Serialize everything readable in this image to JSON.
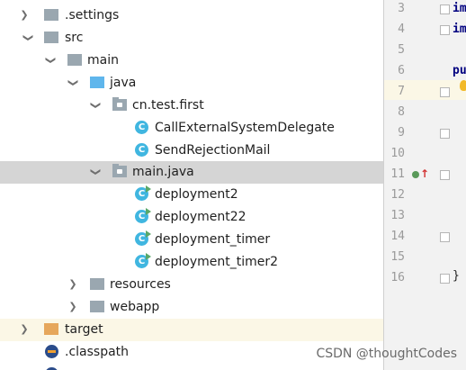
{
  "project_tree": {
    "items": [
      {
        "label": ".settings",
        "expanded": false,
        "icon": "folder-icon"
      },
      {
        "label": "src",
        "expanded": true,
        "icon": "folder-icon"
      },
      {
        "label": "main",
        "expanded": true,
        "icon": "folder-icon"
      },
      {
        "label": "java",
        "expanded": true,
        "icon": "source-folder-icon"
      },
      {
        "label": "cn.test.first",
        "expanded": true,
        "icon": "package-icon"
      },
      {
        "label": "CallExternalSystemDelegate",
        "icon": "class-icon"
      },
      {
        "label": "SendRejectionMail",
        "icon": "class-icon"
      },
      {
        "label": "main.java",
        "expanded": true,
        "selected": true,
        "icon": "package-icon"
      },
      {
        "label": "deployment2",
        "icon": "runnable-class-icon"
      },
      {
        "label": "deployment22",
        "icon": "runnable-class-icon"
      },
      {
        "label": "deployment_timer",
        "icon": "runnable-class-icon"
      },
      {
        "label": "deployment_timer2",
        "icon": "runnable-class-icon"
      },
      {
        "label": "resources",
        "expanded": false,
        "icon": "resources-folder-icon"
      },
      {
        "label": "webapp",
        "expanded": false,
        "icon": "folder-icon"
      },
      {
        "label": "target",
        "expanded": false,
        "icon": "excluded-folder-icon"
      },
      {
        "label": ".classpath",
        "icon": "classpath-icon"
      }
    ]
  },
  "editor": {
    "line_numbers": [
      "3",
      "4",
      "5",
      "6",
      "7",
      "8",
      "9",
      "10",
      "11",
      "12",
      "13",
      "14",
      "15",
      "16"
    ],
    "code_fragments": {
      "line3": "im",
      "line4": "im",
      "line6": "pu",
      "line16": "}"
    },
    "current_line": "7"
  },
  "watermark": "CSDN @thoughtCodes",
  "colors": {
    "selection": "#d5d5d5",
    "highlight_row": "#fbf7e6",
    "class_icon": "#40b6e0",
    "run_marker": "#59a869",
    "gutter_bg": "#f2f2f2"
  }
}
